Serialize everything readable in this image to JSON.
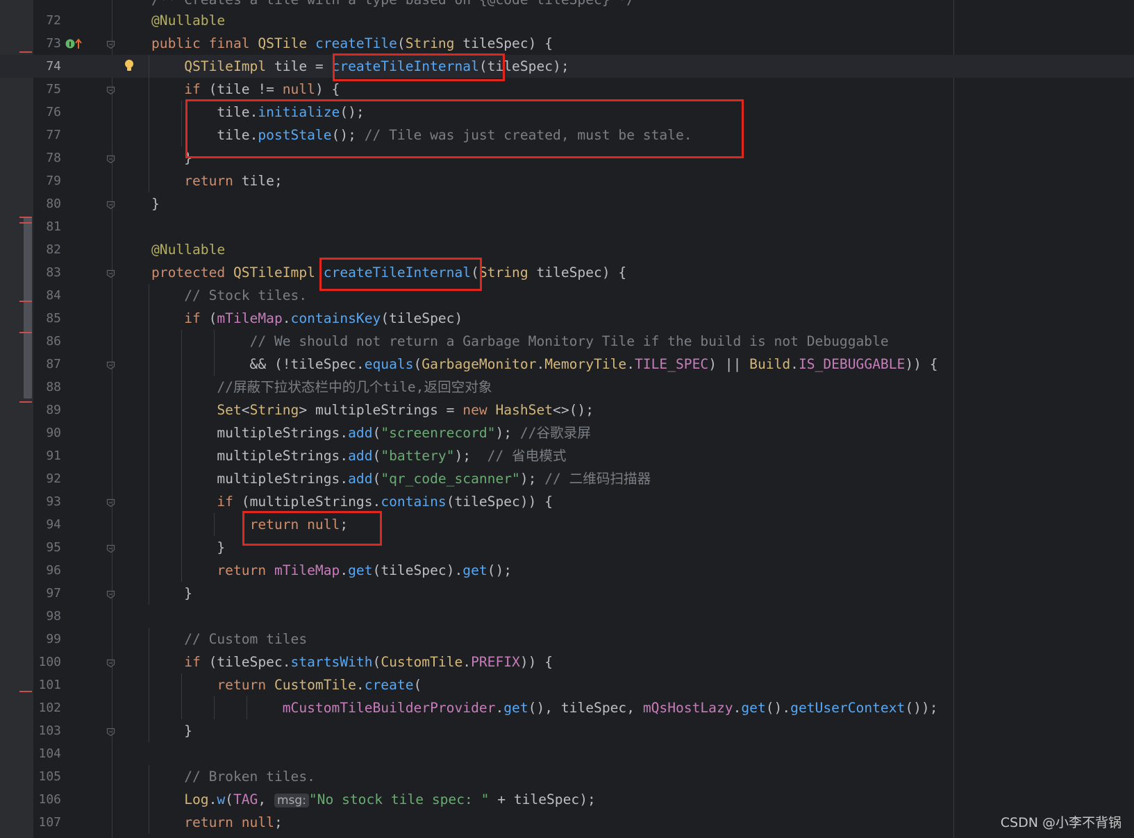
{
  "colors": {
    "background": "#1e1f22",
    "keyword": "#cf8e6d",
    "method": "#56a8f5",
    "field": "#c77dbb",
    "string": "#6aab73",
    "comment": "#7a7e85",
    "annotation": "#b3ae60",
    "type": "#bcbec4",
    "highlight_box": "#e0261d"
  },
  "icons": {
    "usage_gutter": "implementing-method-icon",
    "line_74": "lightbulb-intention-icon",
    "fold": "code-fold-marker-icon"
  },
  "partial_top_line": "/** Creates a tile with a type based on {@code tileSpec} */",
  "lines": [
    {
      "n": "72",
      "code": "@Nullable"
    },
    {
      "n": "73",
      "code": "public final QSTile createTile(String tileSpec) {"
    },
    {
      "n": "74",
      "code": "    QSTileImpl tile = createTileInternal(tileSpec);"
    },
    {
      "n": "75",
      "code": "    if (tile != null) {"
    },
    {
      "n": "76",
      "code": "        tile.initialize();"
    },
    {
      "n": "77",
      "code": "        tile.postStale(); // Tile was just created, must be stale."
    },
    {
      "n": "78",
      "code": "    }"
    },
    {
      "n": "79",
      "code": "    return tile;"
    },
    {
      "n": "80",
      "code": "}"
    },
    {
      "n": "81",
      "code": ""
    },
    {
      "n": "82",
      "code": "@Nullable"
    },
    {
      "n": "83",
      "code": "protected QSTileImpl createTileInternal(String tileSpec) {"
    },
    {
      "n": "84",
      "code": "    // Stock tiles."
    },
    {
      "n": "85",
      "code": "    if (mTileMap.containsKey(tileSpec)"
    },
    {
      "n": "86",
      "code": "            // We should not return a Garbage Monitory Tile if the build is not Debuggable"
    },
    {
      "n": "87",
      "code": "            && (!tileSpec.equals(GarbageMonitor.MemoryTile.TILE_SPEC) || Build.IS_DEBUGGABLE)) {"
    },
    {
      "n": "88",
      "code": "        //屏蔽下拉状态栏中的几个tile,返回空对象"
    },
    {
      "n": "89",
      "code": "        Set<String> multipleStrings = new HashSet<>();"
    },
    {
      "n": "90",
      "code": "        multipleStrings.add(\"screenrecord\"); //谷歌录屏"
    },
    {
      "n": "91",
      "code": "        multipleStrings.add(\"battery\");  // 省电模式"
    },
    {
      "n": "92",
      "code": "        multipleStrings.add(\"qr_code_scanner\"); // 二维码扫描器"
    },
    {
      "n": "93",
      "code": "        if (multipleStrings.contains(tileSpec)) {"
    },
    {
      "n": "94",
      "code": "            return null;"
    },
    {
      "n": "95",
      "code": "        }"
    },
    {
      "n": "96",
      "code": "        return mTileMap.get(tileSpec).get();"
    },
    {
      "n": "97",
      "code": "    }"
    },
    {
      "n": "98",
      "code": ""
    },
    {
      "n": "99",
      "code": "    // Custom tiles"
    },
    {
      "n": "100",
      "code": "    if (tileSpec.startsWith(CustomTile.PREFIX)) {"
    },
    {
      "n": "101",
      "code": "        return CustomTile.create("
    },
    {
      "n": "102",
      "code": "                mCustomTileBuilderProvider.get(), tileSpec, mQsHostLazy.get().getUserContext());"
    },
    {
      "n": "103",
      "code": "    }"
    },
    {
      "n": "104",
      "code": ""
    },
    {
      "n": "105",
      "code": "    // Broken tiles."
    },
    {
      "n": "106",
      "code": "    Log.w(TAG, msg: \"No stock tile spec: \" + tileSpec);"
    },
    {
      "n": "107",
      "code": "    return null;"
    }
  ],
  "inlay_hint": "msg:",
  "watermark": "CSDN @小李不背锅"
}
